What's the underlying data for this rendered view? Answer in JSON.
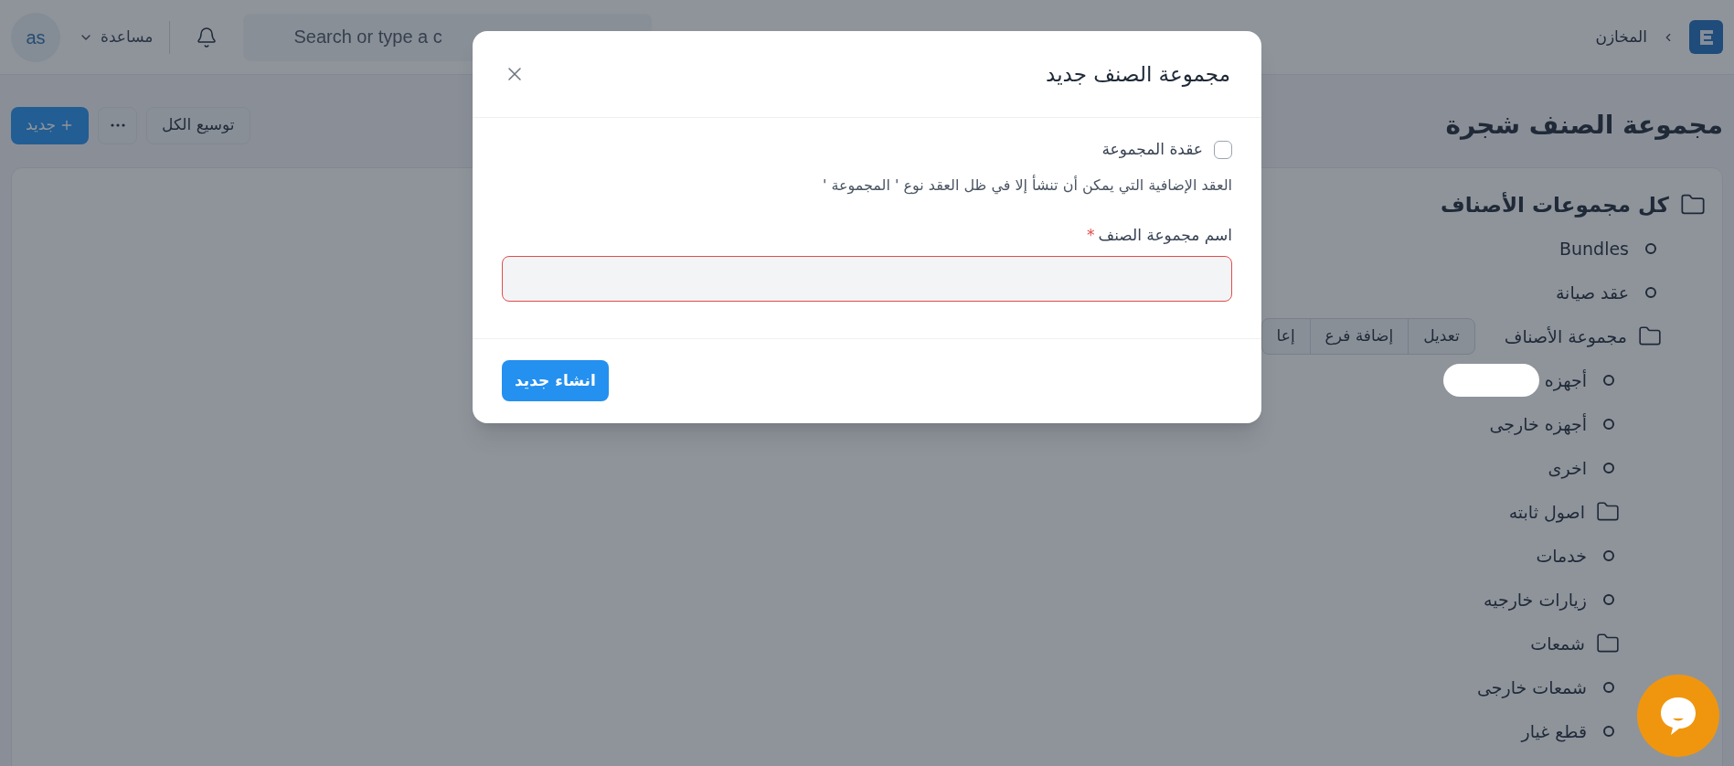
{
  "topbar": {
    "breadcrumb": [
      {
        "label": "المخازن"
      }
    ],
    "search": {
      "placeholder": "Search or type a c"
    },
    "help": {
      "label": "مساعدة"
    },
    "avatar": {
      "initials": "as"
    }
  },
  "page": {
    "title": "مجموعة الصنف شجرة",
    "buttons": [
      {
        "kind": "secondary",
        "label": "توسيع الكل"
      },
      {
        "kind": "more"
      },
      {
        "kind": "primary",
        "label": "جديد"
      }
    ]
  },
  "tree": {
    "label": "كل مجموعات الأصناف",
    "kind": "folder",
    "children": [
      {
        "label": "Bundles",
        "kind": "leaf"
      },
      {
        "label": "عقد صيانة",
        "kind": "leaf"
      },
      {
        "label": "مجموعة الأصناف",
        "kind": "folder",
        "actions": [
          "تعديل",
          "إضافة فرع",
          "إعا"
        ],
        "children": [
          {
            "label": "أجهزه",
            "kind": "leaf",
            "redacted": true
          },
          {
            "label": "أجهزه خارجى",
            "kind": "leaf"
          },
          {
            "label": "اخرى",
            "kind": "leaf"
          },
          {
            "label": "اصول ثابته",
            "kind": "folder"
          },
          {
            "label": "خدمات",
            "kind": "leaf"
          },
          {
            "label": "زيارات خارجيه",
            "kind": "leaf"
          },
          {
            "label": "شمعات",
            "kind": "folder"
          },
          {
            "label": "شمعات خارجى",
            "kind": "leaf"
          },
          {
            "label": "قطع غيار",
            "kind": "leaf"
          }
        ]
      }
    ]
  },
  "modal": {
    "title": "مجموعة الصنف جديد",
    "checkbox": {
      "label": "عقدة المجموعة",
      "checked": false
    },
    "description": "العقد الإضافية التي يمكن أن تنشأ إلا في ظل العقد نوع ' المجموعة '",
    "field": {
      "label": "اسم مجموعة الصنف",
      "required_mark": "*"
    },
    "submit": "انشاء جديد"
  }
}
